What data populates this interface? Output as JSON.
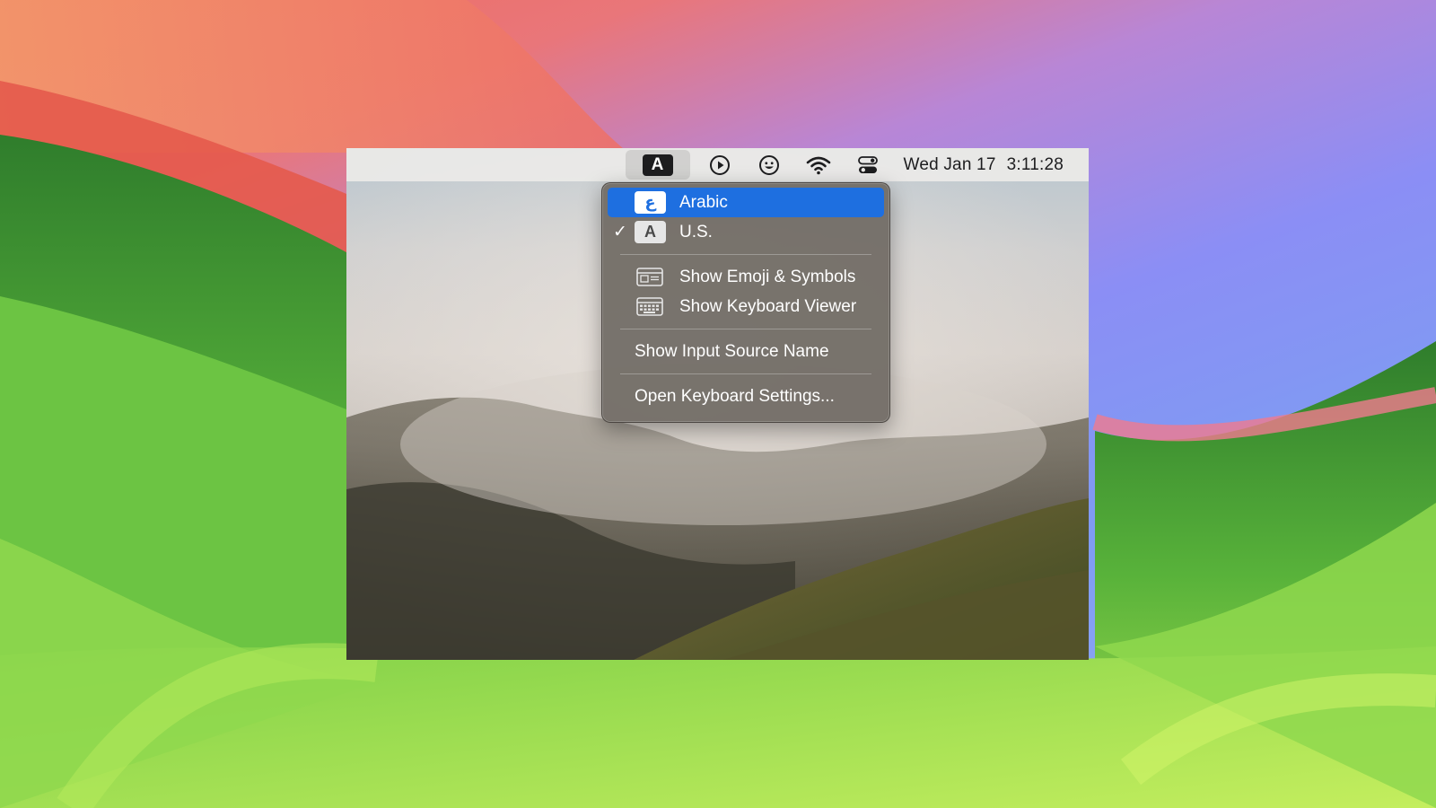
{
  "menubar": {
    "input_source_letter": "A",
    "status_icons": [
      "play-circle-icon",
      "emoji-face-icon",
      "wifi-icon",
      "control-center-icon"
    ],
    "clock": {
      "date": "Wed Jan 17",
      "time": "3:11:28"
    }
  },
  "input_menu": {
    "sources": [
      {
        "name": "Arabic",
        "badge": "ع",
        "checked": false,
        "highlighted": true
      },
      {
        "name": "U.S.",
        "badge": "A",
        "checked": true,
        "highlighted": false
      }
    ],
    "checkmark": "✓",
    "viewers": [
      {
        "label": "Show Emoji & Symbols",
        "icon": "emoji-symbols-icon"
      },
      {
        "label": "Show Keyboard Viewer",
        "icon": "keyboard-viewer-icon"
      }
    ],
    "show_input_source_name": "Show Input Source Name",
    "open_keyboard_settings": "Open Keyboard Settings..."
  },
  "colors": {
    "highlight": "#1e6fe0",
    "menu_background": "#706a64"
  }
}
